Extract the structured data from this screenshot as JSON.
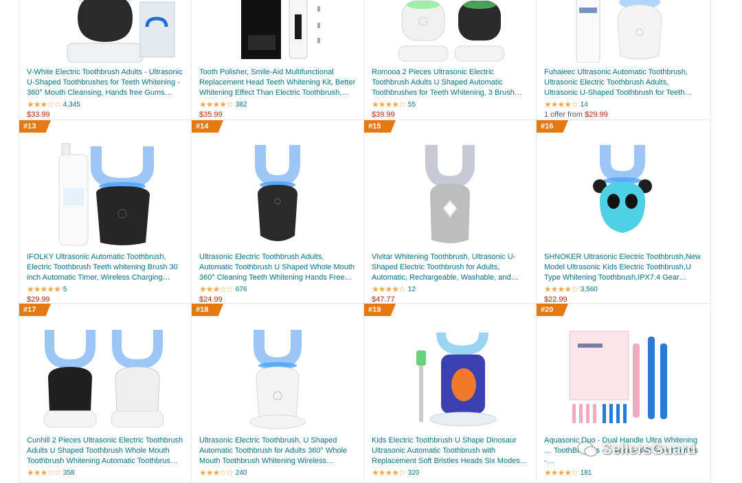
{
  "rows": [
    [
      {
        "rank": "",
        "title": "V-White Electric Toothbrush Adults - Ultrasonic U-Shaped Toothbrushes for Teeth Whitening - 360° Mouth Cleansing, Hands free Gums…",
        "stars": "★★★☆☆",
        "reviews": "4,345",
        "price": "$33.99"
      },
      {
        "rank": "",
        "title": "Tooth Polisher, Smile-Aid Multifunctional Replacement Head Teeth Whitening Kit, Better Whitening Effect Than Electric Toothbrush,…",
        "stars": "★★★★☆",
        "reviews": "382",
        "price": "$35.99"
      },
      {
        "rank": "",
        "title": "Romooa 2 Pieces Ultrasonic Electric Toothbrush Adults U Shaped Automatic Toothbrushes for Teeth Whitening, 3 Brush…",
        "stars": "★★★★☆",
        "reviews": "55",
        "price": "$39.99"
      },
      {
        "rank": "",
        "title": "Fuhaieec Ultrasonic Automatic Toothbrush, Ultrasonic Electric Toothbrush Adults, Ultrasonic U-Shaped Toothbrush for Teeth…",
        "stars": "★★★★☆",
        "reviews": "14",
        "offer_prefix": "1 offer from ",
        "offer_price": "$29.99"
      }
    ],
    [
      {
        "rank": "#13",
        "title": "IFOLKY Ultrasonic Automatic Toothbrush, Electric Toothbrush Teeth whitening Brush 30 inch Automatic Timer, Wireless Charging 360…",
        "stars": "★★★★★",
        "reviews": "5",
        "price": "$29.99"
      },
      {
        "rank": "#14",
        "title": "Ultrasonic Electric Toothbrush Adults, Automatic Toothbrush U Shaped Whole Mouth 360° Cleaning Teeth Whitening Hands Free…",
        "stars": "★★★☆☆",
        "reviews": "676",
        "price": "$24.99"
      },
      {
        "rank": "#15",
        "title": "Vivitar Whitening Toothbrush, Ultrasonic U-Shaped Electric Toothbrush for Adults, Automatic, Rechargeable, Washable, and…",
        "stars": "★★★★☆",
        "reviews": "12",
        "price": "$47.77"
      },
      {
        "rank": "#16",
        "title": "SHNOKER Ultrasonic Electric Toothbrush,New Model Ultrasonic Kids Electric Toothbrush,U Type Whitening Toothbrush,IPX7.4 Gear…",
        "stars": "★★★★☆",
        "reviews": "3,560",
        "price": "$22.99"
      }
    ],
    [
      {
        "rank": "#17",
        "title": "Cunhill 2 Pieces Ultrasonic Electric Toothbrush Adults U Shaped Toothbrush Whole Mouth Toothbrush Whitening Automatic Toothbrus…",
        "stars": "★★★☆☆",
        "reviews": "358",
        "price": ""
      },
      {
        "rank": "#18",
        "title": "Ultrasonic Electric Toothbrush, U Shaped Automatic Toothbrush for Adults 360° Whole Mouth Toothbrush Whitening Wireless…",
        "stars": "★★★☆☆",
        "reviews": "240",
        "price": ""
      },
      {
        "rank": "#19",
        "title": "Kids Electric Toothbrush U Shape Dinosaur Ultrasonic Automatic Toothbrush with Replacement Soft Bristles Heads Six Modes…",
        "stars": "★★★★☆",
        "reviews": "320",
        "price": ""
      },
      {
        "rank": "#20",
        "title": "Aquasonic Duo - Dual Handle Ultra Whitening … ToothBrushes - 3 Modes with Smart Timers -…",
        "stars": "★★★★☆",
        "reviews": "181",
        "price": ""
      }
    ]
  ],
  "watermark": "SellersGuard"
}
